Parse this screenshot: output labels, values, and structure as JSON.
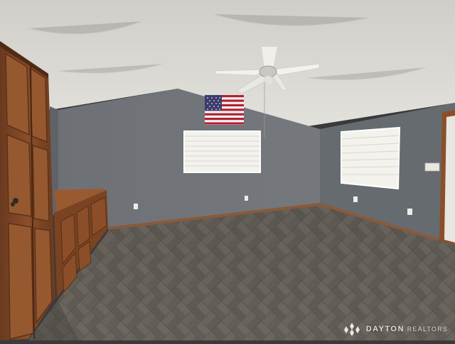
{
  "scene": {
    "description_tags": [
      "interior-room",
      "vaulted-ceiling",
      "ceiling-fan",
      "american-flag",
      "parquet-floor",
      "wood-cabinets",
      "two-windows"
    ],
    "colors": {
      "wall": "#6b6f73",
      "wall_right": "#646a70",
      "ceiling": "#d9d8d4",
      "floor": "#6f6a62",
      "floor_dark": "#55514b",
      "wood": "#8a4f2a",
      "wood_dark": "#5e331a",
      "window": "#f3f1ea",
      "baseboard": "#8a5a3a"
    }
  },
  "watermark": {
    "brand": "DAYTON",
    "sub": "REALTORS"
  }
}
